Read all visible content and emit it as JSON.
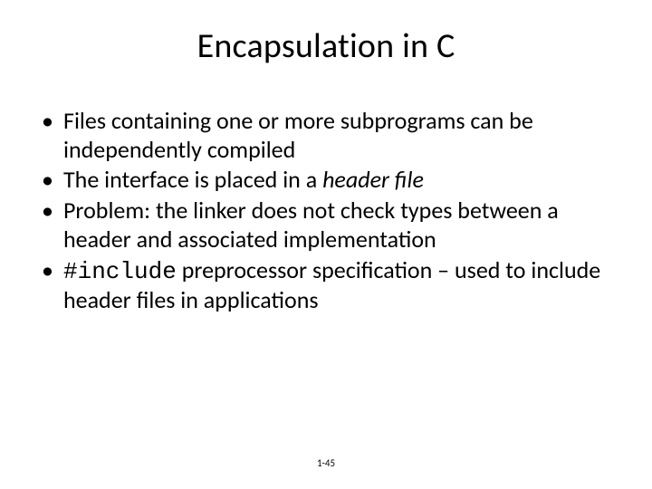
{
  "slide": {
    "title": "Encapsulation in C",
    "bullets": [
      {
        "text": "Files containing one or more subprograms can be independently compiled"
      },
      {
        "pre": "The interface is placed in a ",
        "em": "header file",
        "post": ""
      },
      {
        "text": "Problem: the linker does not check types between a header and associated implementation"
      },
      {
        "code": "#include",
        "post": " preprocessor specification – used to include header files in applications"
      }
    ],
    "footer": "1-45"
  }
}
